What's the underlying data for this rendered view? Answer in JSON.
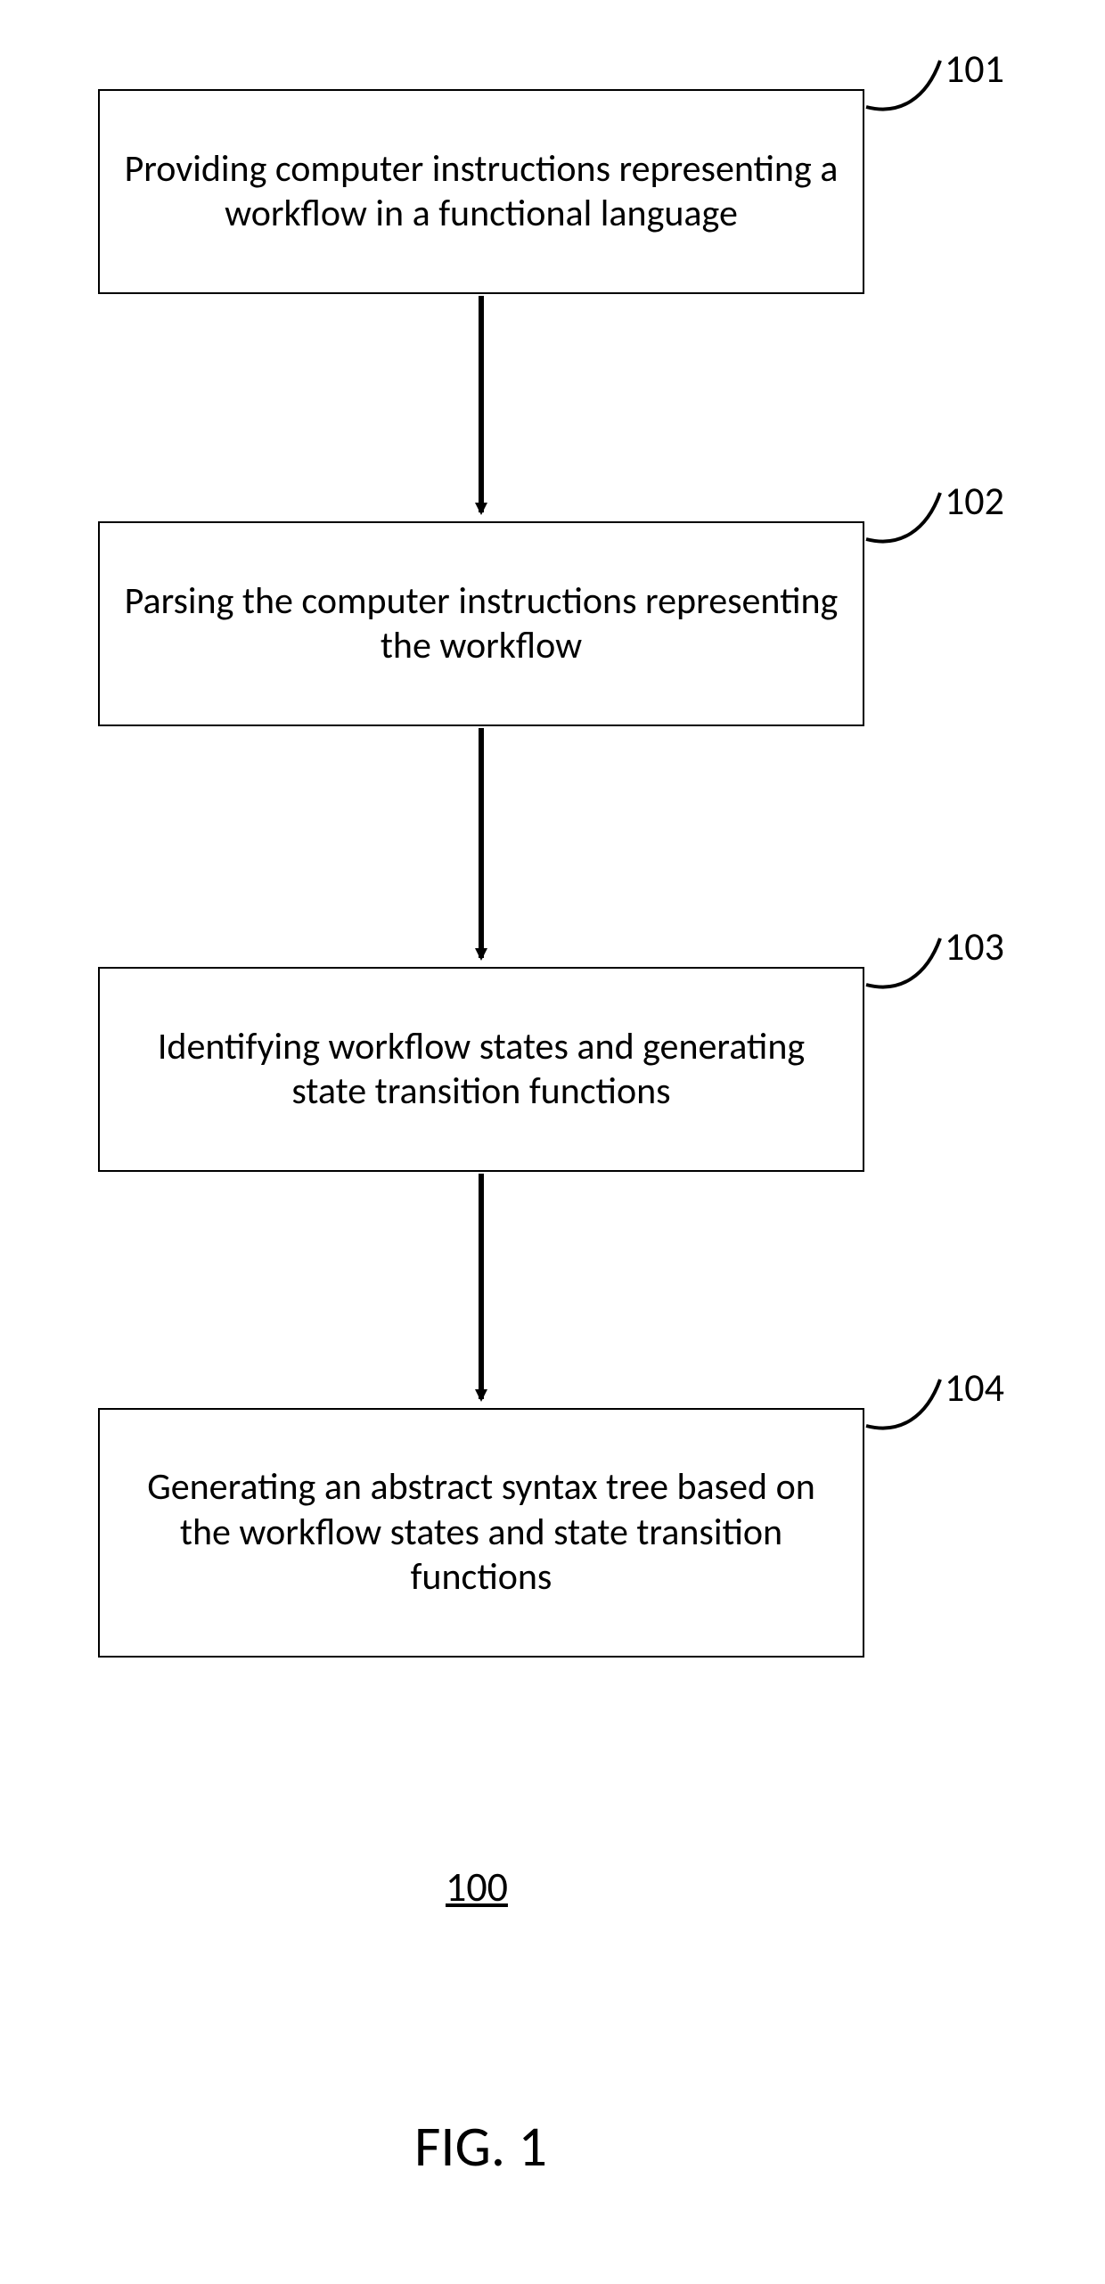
{
  "steps": [
    {
      "ref": "101",
      "text": "Providing computer instructions representing a workflow in a functional language"
    },
    {
      "ref": "102",
      "text": "Parsing the computer instructions representing the workflow"
    },
    {
      "ref": "103",
      "text": "Identifying workflow states and generating state transition functions"
    },
    {
      "ref": "104",
      "text": "Generating an abstract syntax tree based on the workflow states and state transition functions"
    }
  ],
  "figure_number": "100",
  "figure_caption": "FIG. 1"
}
